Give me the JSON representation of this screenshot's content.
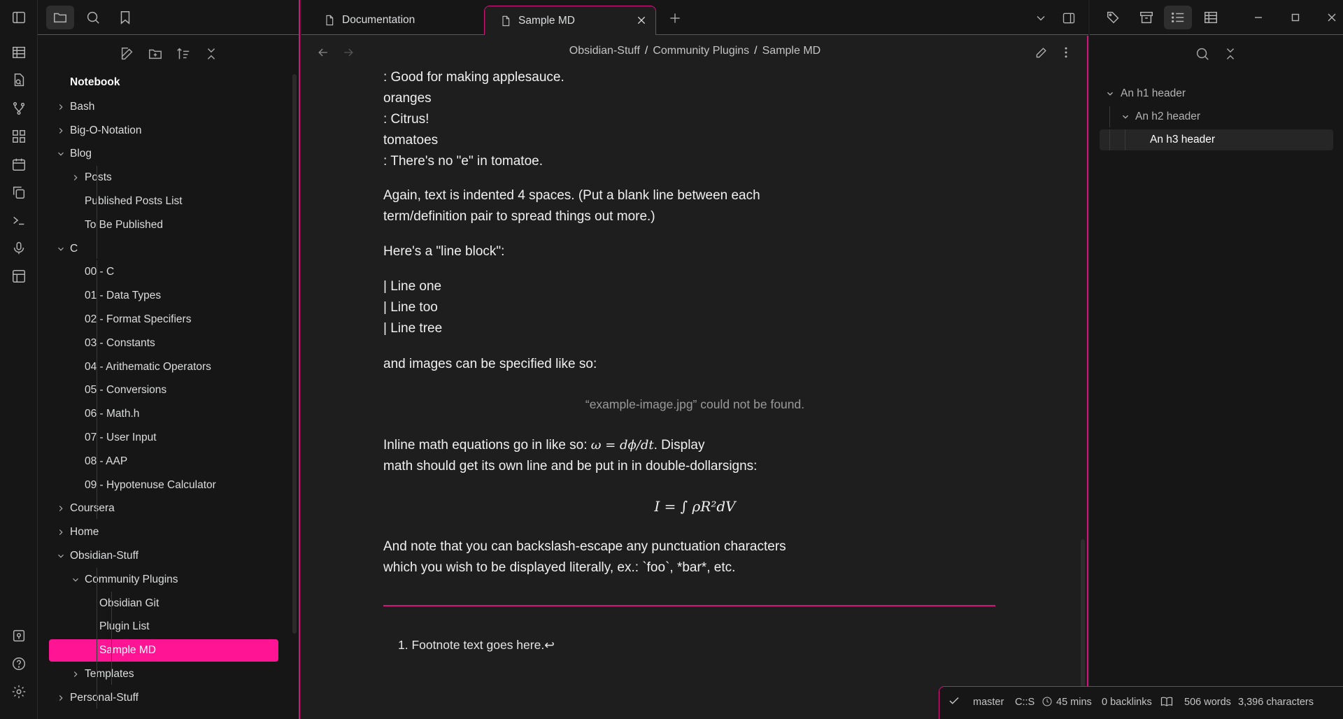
{
  "ribbon": {
    "icons": [
      "table-icon",
      "file-search-icon",
      "git-branch-icon",
      "dashboard-icon",
      "calendar-icon",
      "copy-icon",
      "terminal-icon",
      "microphone-icon",
      "layout-icon"
    ],
    "bottom_icons": [
      "vault-icon",
      "help-icon",
      "settings-icon"
    ]
  },
  "file_tree": {
    "root": "Notebook",
    "items": [
      {
        "label": "Bash",
        "depth": 0,
        "folder": true,
        "expanded": false
      },
      {
        "label": "Big-O-Notation",
        "depth": 0,
        "folder": true,
        "expanded": false
      },
      {
        "label": "Blog",
        "depth": 0,
        "folder": true,
        "expanded": true
      },
      {
        "label": "Posts",
        "depth": 1,
        "folder": true,
        "expanded": false
      },
      {
        "label": "Published Posts List",
        "depth": 1,
        "folder": false
      },
      {
        "label": "To Be Published",
        "depth": 1,
        "folder": false
      },
      {
        "label": "C",
        "depth": 0,
        "folder": true,
        "expanded": true
      },
      {
        "label": "00 - C",
        "depth": 1,
        "folder": false
      },
      {
        "label": "01 - Data Types",
        "depth": 1,
        "folder": false
      },
      {
        "label": "02 - Format Specifiers",
        "depth": 1,
        "folder": false
      },
      {
        "label": "03 - Constants",
        "depth": 1,
        "folder": false
      },
      {
        "label": "04 - Arithematic Operators",
        "depth": 1,
        "folder": false
      },
      {
        "label": "05 - Conversions",
        "depth": 1,
        "folder": false
      },
      {
        "label": "06 - Math.h",
        "depth": 1,
        "folder": false
      },
      {
        "label": "07 - User Input",
        "depth": 1,
        "folder": false
      },
      {
        "label": "08 - AAP",
        "depth": 1,
        "folder": false
      },
      {
        "label": "09 - Hypotenuse Calculator",
        "depth": 1,
        "folder": false
      },
      {
        "label": "Coursera",
        "depth": 0,
        "folder": true,
        "expanded": false
      },
      {
        "label": "Home",
        "depth": 0,
        "folder": true,
        "expanded": false
      },
      {
        "label": "Obsidian-Stuff",
        "depth": 0,
        "folder": true,
        "expanded": true
      },
      {
        "label": "Community Plugins",
        "depth": 1,
        "folder": true,
        "expanded": true
      },
      {
        "label": "Obsidian Git",
        "depth": 2,
        "folder": false
      },
      {
        "label": "Plugin List",
        "depth": 2,
        "folder": false
      },
      {
        "label": "Sample MD",
        "depth": 2,
        "folder": false,
        "active": true
      },
      {
        "label": "Templates",
        "depth": 1,
        "folder": true,
        "expanded": false
      },
      {
        "label": "Personal-Stuff",
        "depth": 0,
        "folder": true,
        "expanded": false
      }
    ]
  },
  "tabs": [
    {
      "label": "Documentation",
      "active": false
    },
    {
      "label": "Sample MD",
      "active": true
    }
  ],
  "breadcrumb": [
    "Obsidian-Stuff",
    "Community Plugins",
    "Sample MD"
  ],
  "content": {
    "deflist": [
      ": Good for making applesauce.",
      "oranges",
      ": Citrus!",
      "tomatoes",
      ": There's no \"e\" in tomatoe."
    ],
    "para1_line1": "Again, text is indented 4 spaces. (Put a blank line between each",
    "para1_line2": "term/definition pair to spread things out more.)",
    "line_block_intro": "Here's a \"line block\":",
    "line_block": [
      "| Line one",
      "| Line too",
      "| Line tree"
    ],
    "images_intro": "and images can be specified like so:",
    "image_missing": "“example-image.jpg” could not be found.",
    "math_line1_pre": "Inline math equations go in like so: ",
    "math_inline": "ω = dϕ/dt",
    "math_line1_post": ". Display",
    "math_line2": "math should get its own line and be put in in double-dollarsigns:",
    "math_display": "I = ∫ ρR²dV",
    "escape_line1": "And note that you can backslash-escape any punctuation characters",
    "escape_line2": "which you wish to be displayed literally, ex.: `foo`, *bar*, etc.",
    "footnote_number": "1.",
    "footnote": "Footnote text goes here.",
    "footnote_backref": "↩"
  },
  "outline": [
    {
      "label": "An h1 header",
      "level": 1
    },
    {
      "label": "An h2 header",
      "level": 2
    },
    {
      "label": "An h3 header",
      "level": 3,
      "active": true
    }
  ],
  "status": {
    "branch": "master",
    "git_status": "C::S",
    "time": "45 mins",
    "backlinks": "0 backlinks",
    "words": "506 words",
    "characters": "3,396 characters"
  },
  "colors": {
    "accent": "#ff1493",
    "border": "#d4147d",
    "background": "#1e1e1e",
    "sidebar": "#161616"
  }
}
